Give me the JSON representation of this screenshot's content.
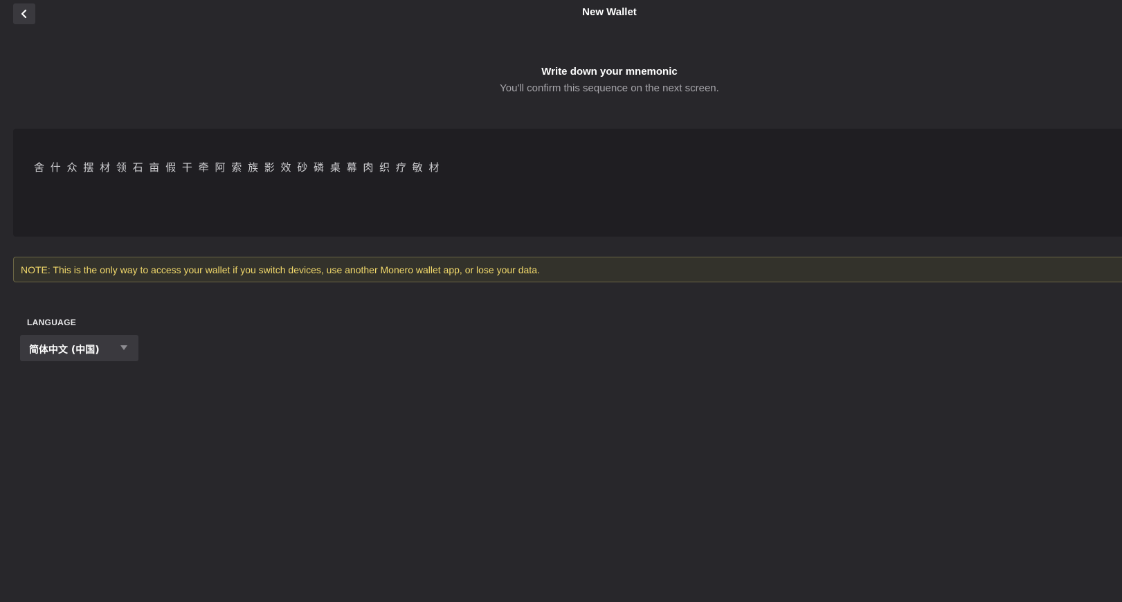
{
  "header": {
    "title": "New Wallet",
    "back_icon": "chevron-left-icon"
  },
  "intro": {
    "heading": "Write down your mnemonic",
    "subheading": "You'll confirm this sequence on the next screen."
  },
  "mnemonic": {
    "words": "舍 什 众 摆 材 领 石 亩 假 干 牵 阿 索 族 影 效 砂 磷 桌 幕 肉 织 疗 敏 材"
  },
  "note": {
    "text": "NOTE: This is the only way to access your wallet if you switch devices, use another Monero wallet app, or lose your data."
  },
  "language": {
    "label": "LANGUAGE",
    "selected": "简体中文 (中国)",
    "dropdown_icon": "caret-down-icon"
  },
  "colors": {
    "background": "#28272b",
    "panel": "#1f1e22",
    "note_text": "#f2d96b",
    "note_border": "#6a6544"
  }
}
